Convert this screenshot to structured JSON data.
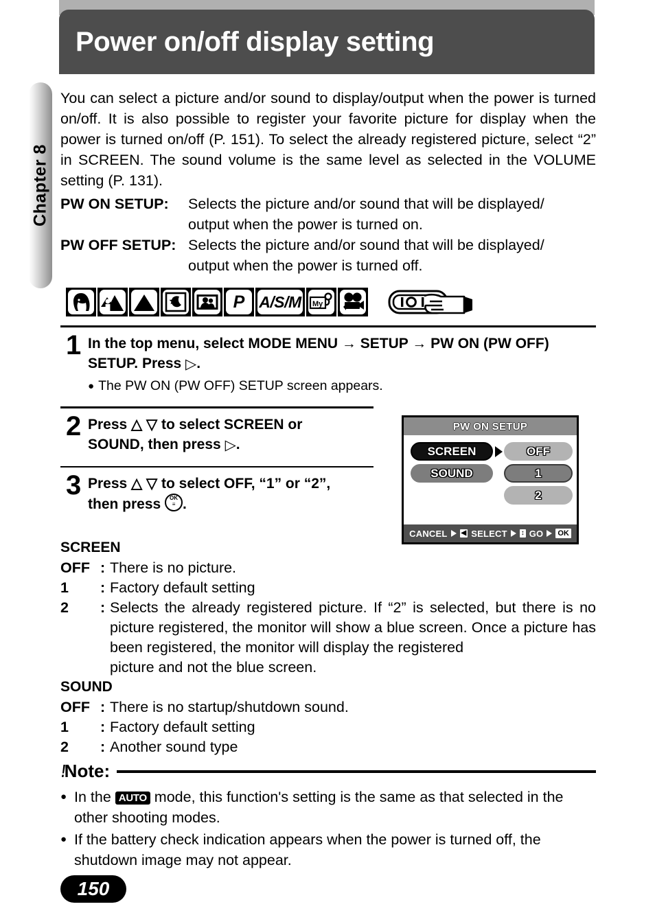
{
  "chapter_tab": {
    "label": "Chapter 8"
  },
  "header": {
    "title": "Power on/off display setting"
  },
  "intro": {
    "paragraph": "You can select a picture and/or sound to display/output when the power is turned on/off. It is also possible to register your favorite picture for display when the power is turned on/off (P. 151). To select the already registered picture, select “2” in SCREEN. The sound volume is the same level as selected in the VOLUME setting (P. 131)."
  },
  "definitions": [
    {
      "term": "PW ON SETUP:",
      "line1": "Selects the picture and/or sound that will be displayed/",
      "line2": "output when the power is turned on."
    },
    {
      "term": "PW OFF SETUP:",
      "line1": "Selects the picture and/or sound that will be displayed/",
      "line2": "output when the power is turned off."
    }
  ],
  "mode_icons": [
    {
      "name": "portrait-mode-icon",
      "label": ""
    },
    {
      "name": "portrait-landscape-mode-icon",
      "label": ""
    },
    {
      "name": "landscape-mode-icon",
      "label": ""
    },
    {
      "name": "night-scene-mode-icon",
      "label": ""
    },
    {
      "name": "self-portrait-mode-icon",
      "label": ""
    },
    {
      "name": "program-mode-icon",
      "label": "P"
    },
    {
      "name": "asm-mode-icon",
      "label": "A/S/M"
    },
    {
      "name": "my-mode-icon",
      "label": "My"
    },
    {
      "name": "movie-mode-icon",
      "label": ""
    }
  ],
  "hand_icon": {
    "name": "hand-pointing-dial-icon"
  },
  "steps": [
    {
      "number": "1",
      "line1_a": "In the top menu, select MODE MENU",
      "arrow": "→",
      "line1_b": "SETUP",
      "line1_c": "PW ON (PW OFF)",
      "line2_a": "SETUP. Press",
      "line2_triangle": "▷",
      "line2_b": ".",
      "bullet": "The PW ON (PW OFF) SETUP screen appears."
    },
    {
      "number": "2",
      "line1": "Press  △ ▽  to select SCREEN or",
      "line2_a": "SOUND, then press",
      "line2_triangle": "▷",
      "line2_b": "."
    },
    {
      "number": "3",
      "line1": "Press  △ ▽  to select OFF, “1” or “2”,",
      "line2_a": "then press",
      "line2_b": "."
    }
  ],
  "lcd": {
    "title": "PW ON SETUP",
    "left_items": [
      {
        "label": "SCREEN",
        "selected": true
      },
      {
        "label": "SOUND",
        "selected": false
      }
    ],
    "right_items": [
      {
        "label": "OFF",
        "highlighted": false
      },
      {
        "label": "1",
        "highlighted": true
      },
      {
        "label": "2",
        "highlighted": false
      }
    ],
    "footer": {
      "cancel_label": "CANCEL",
      "select_label": "SELECT",
      "go_label": "GO",
      "ok_key": "OK",
      "left_key": "◀",
      "updown_key": "↕"
    }
  },
  "screen_section": {
    "heading": "SCREEN",
    "options": [
      {
        "key": "OFF",
        "colon": ":",
        "value": "There is no picture."
      },
      {
        "key": "1",
        "colon": ":",
        "value": "Factory default setting"
      },
      {
        "key": "2",
        "colon": ":",
        "value": "Selects the already registered picture. If “2” is selected, but there  is no picture registered, the monitor will show a blue screen. Once a picture has been registered, the monitor will display the registered",
        "value_last": "picture and not the blue screen."
      }
    ]
  },
  "sound_section": {
    "heading": "SOUND",
    "options": [
      {
        "key": "OFF",
        "colon": ":",
        "value": "There is no startup/shutdown sound."
      },
      {
        "key": "1",
        "colon": ":",
        "value": "Factory default setting"
      },
      {
        "key": "2",
        "colon": ":",
        "value": "Another sound type"
      }
    ]
  },
  "note": {
    "bang": "⁄",
    "label": "Note:",
    "items": [
      {
        "prefix": "In the",
        "badge": "AUTO",
        "text": "mode, this function's setting is the same as that selected in the",
        "last": "other shooting modes."
      },
      {
        "prefix": "",
        "badge": "",
        "text": "If the battery check indication appears when the power is turned off, the",
        "last": "shutdown image may not appear."
      }
    ]
  },
  "page_number": "150",
  "colors": {
    "title_bar": "#4d4d4d",
    "top_band": "#b0b0b0",
    "lcd_header": "#8c8c8c",
    "lcd_footer": "#4f4f4f",
    "pill_light": "#b3b3b3",
    "pill_mid": "#7d7d7d",
    "pill_dark": "#111111"
  }
}
